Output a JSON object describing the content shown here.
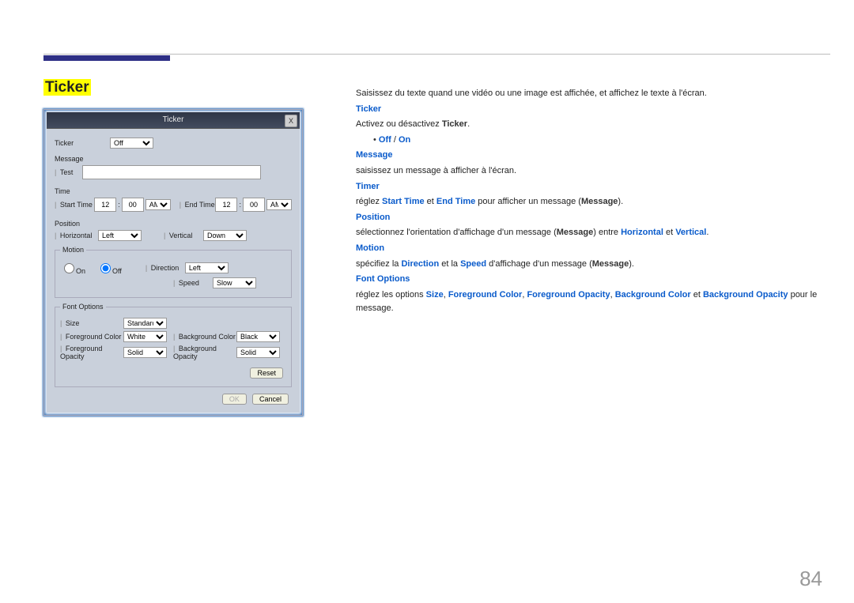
{
  "page_number": "84",
  "title": "Ticker",
  "right": {
    "intro": "Saisissez du texte quand une vidéo ou une image est affichée, et affichez le texte à l'écran.",
    "ticker_h": "Ticker",
    "ticker_desc_a": "Activez ou désactivez ",
    "ticker_desc_b": "Ticker",
    "ticker_desc_c": ".",
    "off": "Off",
    "on": "On",
    "slash": " / ",
    "message_h": "Message",
    "message_desc": "saisissez un message à afficher à l'écran.",
    "timer_h": "Timer",
    "timer_pre": "réglez ",
    "start_time": "Start Time",
    "and": " et ",
    "end_time": "End Time",
    "timer_mid": " pour afficher un message (",
    "msg_word": "Message",
    "close_par": ").",
    "position_h": "Position",
    "pos_a": "sélectionnez l'orientation d'affichage d'un message (",
    "pos_b": ") entre ",
    "horizontal": "Horizontal",
    "vertical": "Vertical",
    "motion_h": "Motion",
    "mot_a": "spécifiez la ",
    "direction": "Direction",
    "mot_b": " et la ",
    "speed": "Speed",
    "mot_c": " d'affichage d'un message (",
    "font_h": "Font Options",
    "font_a": "réglez les options ",
    "size": "Size",
    "sep": ", ",
    "fgc": "Foreground Color",
    "fgo": "Foreground Opacity",
    "bgc": "Background Color",
    "bgo": "Background Opacity",
    "font_b": " pour le message.",
    "font_end": " et "
  },
  "win": {
    "title": "Ticker",
    "close": "X",
    "ticker_lbl": "Ticker",
    "off_opt": "Off",
    "message_lbl": "Message",
    "test": "Test",
    "time_lbl": "Time",
    "start": "Start Time",
    "end": "End Time",
    "h12": "12",
    "m00": "00",
    "am": "AM",
    "position_lbl": "Position",
    "horizontal": "Horizontal",
    "left": "Left",
    "vertical": "Vertical",
    "down": "Down",
    "motion_lbl": "Motion",
    "on": "On",
    "off": "Off",
    "direction": "Direction",
    "speed": "Speed",
    "slow": "Slow",
    "font_lbl": "Font Options",
    "size": "Size",
    "standard": "Standard",
    "fgc": "Foreground Color",
    "white": "White",
    "bgc": "Background Color",
    "black": "Black",
    "fgo": "Foreground Opacity",
    "solid": "Solid",
    "bgo": "Background Opacity",
    "reset": "Reset",
    "ok": "OK",
    "cancel": "Cancel"
  }
}
